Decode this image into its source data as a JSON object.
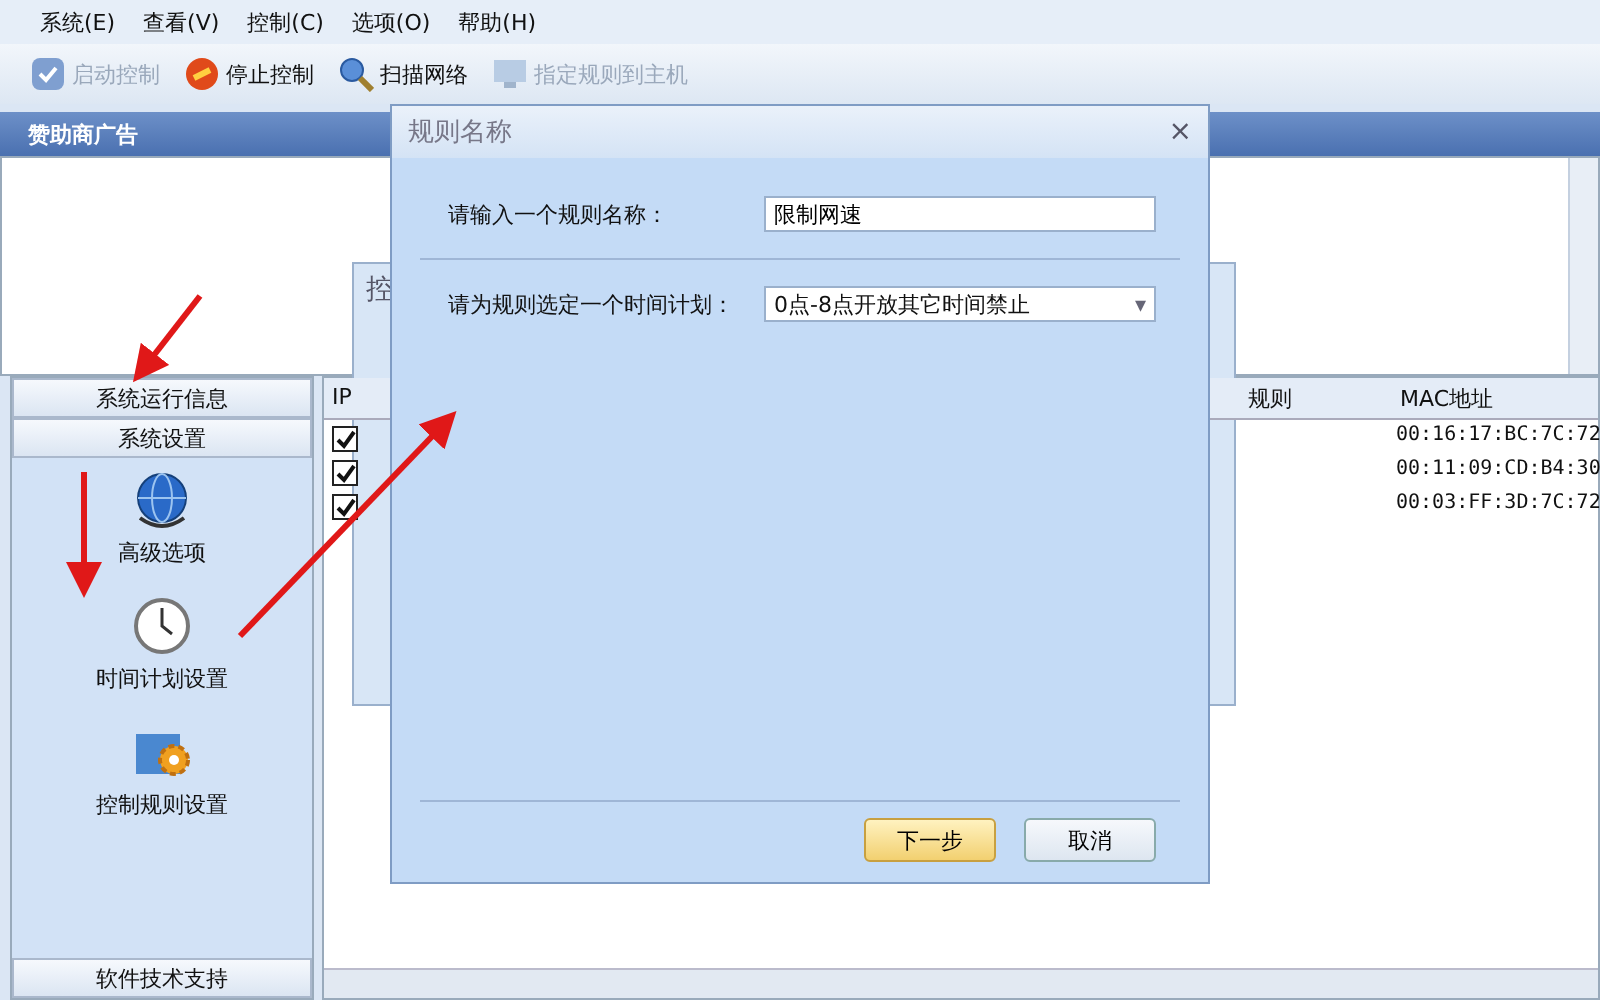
{
  "menu": [
    "系统(E)",
    "查看(V)",
    "控制(C)",
    "选项(O)",
    "帮助(H)"
  ],
  "toolbar": [
    {
      "label": "启动控制",
      "disabled": true,
      "kind": "start"
    },
    {
      "label": "停止控制",
      "disabled": false,
      "kind": "stop"
    },
    {
      "label": "扫描网络",
      "disabled": false,
      "kind": "scan"
    },
    {
      "label": "指定规则到主机",
      "disabled": true,
      "kind": "assign"
    }
  ],
  "banner": {
    "title": "赞助商广告"
  },
  "sidebar": {
    "sections": [
      "系统运行信息",
      "系统设置"
    ],
    "items": [
      {
        "label": "高级选项",
        "kind": "globe"
      },
      {
        "label": "时间计划设置",
        "kind": "clock"
      },
      {
        "label": "控制规则设置",
        "kind": "gear"
      }
    ],
    "footer": "软件技术支持"
  },
  "background_window": {
    "title": "控"
  },
  "table": {
    "columns": [
      "IP",
      "规则",
      "MAC地址"
    ],
    "rows": [
      {
        "checked": true,
        "mac": "00:16:17:BC:7C:72"
      },
      {
        "checked": true,
        "mac": "00:11:09:CD:B4:30"
      },
      {
        "checked": true,
        "mac": "00:03:FF:3D:7C:72"
      }
    ]
  },
  "dialog": {
    "title": "规则名称",
    "close_glyph": "×",
    "dropdown_glyph": "▾",
    "name_label": "请输入一个规则名称：",
    "name_value": "限制网速",
    "plan_label": "请为规则选定一个时间计划：",
    "plan_value": "0点-8点开放其它时间禁止",
    "buttons": [
      "下一步",
      "取消"
    ]
  }
}
